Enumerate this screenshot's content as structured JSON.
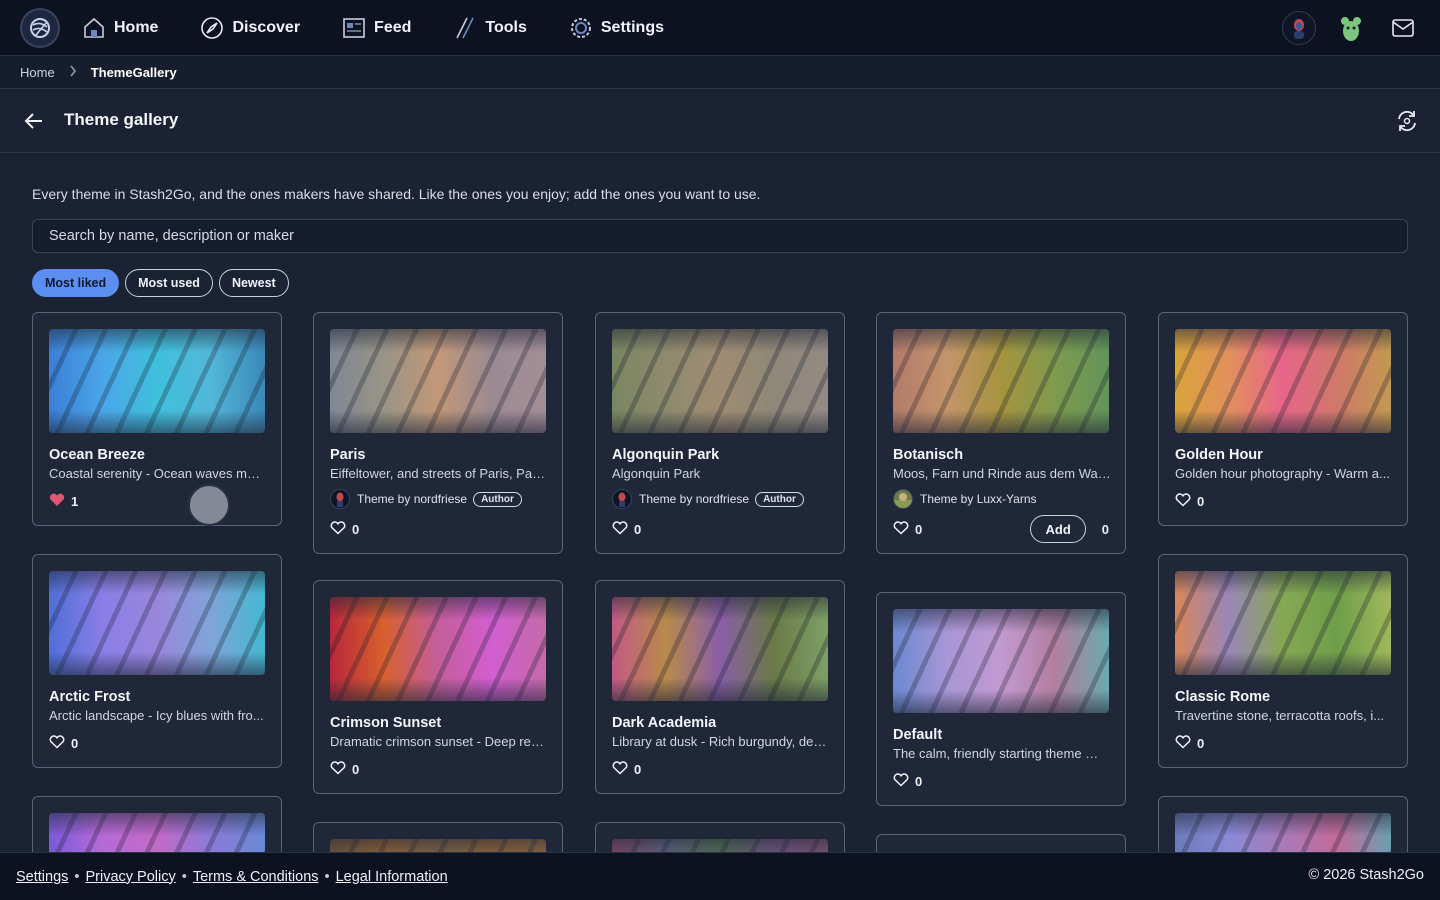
{
  "nav": {
    "items": [
      {
        "label": "Home",
        "icon": "home-icon"
      },
      {
        "label": "Discover",
        "icon": "compass-icon"
      },
      {
        "label": "Feed",
        "icon": "feed-icon"
      },
      {
        "label": "Tools",
        "icon": "tools-icon"
      },
      {
        "label": "Settings",
        "icon": "settings-icon"
      }
    ]
  },
  "breadcrumb": {
    "home": "Home",
    "current": "ThemeGallery"
  },
  "page": {
    "title": "Theme gallery"
  },
  "intro": "Every theme in Stash2Go, and the ones makers have shared. Like the ones you enjoy; add the ones you want to use.",
  "search": {
    "placeholder": "Search by name, description or maker"
  },
  "sort": {
    "active": "Most liked",
    "options": [
      "Most liked",
      "Most used",
      "Newest"
    ]
  },
  "labels": {
    "theme_by": "Theme by",
    "author_badge": "Author",
    "add": "Add"
  },
  "colors": {
    "accent": "#5b8ef0",
    "liked_heart": "#e0566f",
    "card_border": "#5a6478"
  },
  "cards": [
    {
      "title": "Ocean Breeze",
      "desc": "Coastal serenity - Ocean waves mee...",
      "likes": "1",
      "liked": true
    },
    {
      "title": "Paris",
      "desc": "Eiffeltower, and streets of Paris, Pari...",
      "maker": "nordfriese",
      "author": true,
      "likes": "0"
    },
    {
      "title": "Algonquin Park",
      "desc": "Algonquin Park",
      "maker": "nordfriese",
      "author": true,
      "likes": "0"
    },
    {
      "title": "Botanisch",
      "desc": "Moos, Farn und Rinde aus dem Wald...",
      "maker": "Luxx-Yarns",
      "likes": "0",
      "uses": "0"
    },
    {
      "title": "Golden Hour",
      "desc": "Golden hour photography - Warm a...",
      "likes": "0"
    },
    {
      "title": "Arctic Frost",
      "desc": "Arctic landscape - Icy blues with fro...",
      "likes": "0"
    },
    {
      "title": "Crimson Sunset",
      "desc": "Dramatic crimson sunset - Deep red...",
      "likes": "0"
    },
    {
      "title": "Dark Academia",
      "desc": "Library at dusk - Rich burgundy, dee...",
      "likes": "0"
    },
    {
      "title": "Default",
      "desc": "The calm, friendly starting theme — ...",
      "likes": "0"
    },
    {
      "title": "Classic Rome",
      "desc": "Travertine stone, terracotta roofs, i...",
      "likes": "0"
    }
  ],
  "footer": {
    "links": [
      "Settings",
      "Privacy Policy",
      "Terms & Conditions",
      "Legal Information"
    ],
    "copyright": "© 2026 Stash2Go"
  }
}
